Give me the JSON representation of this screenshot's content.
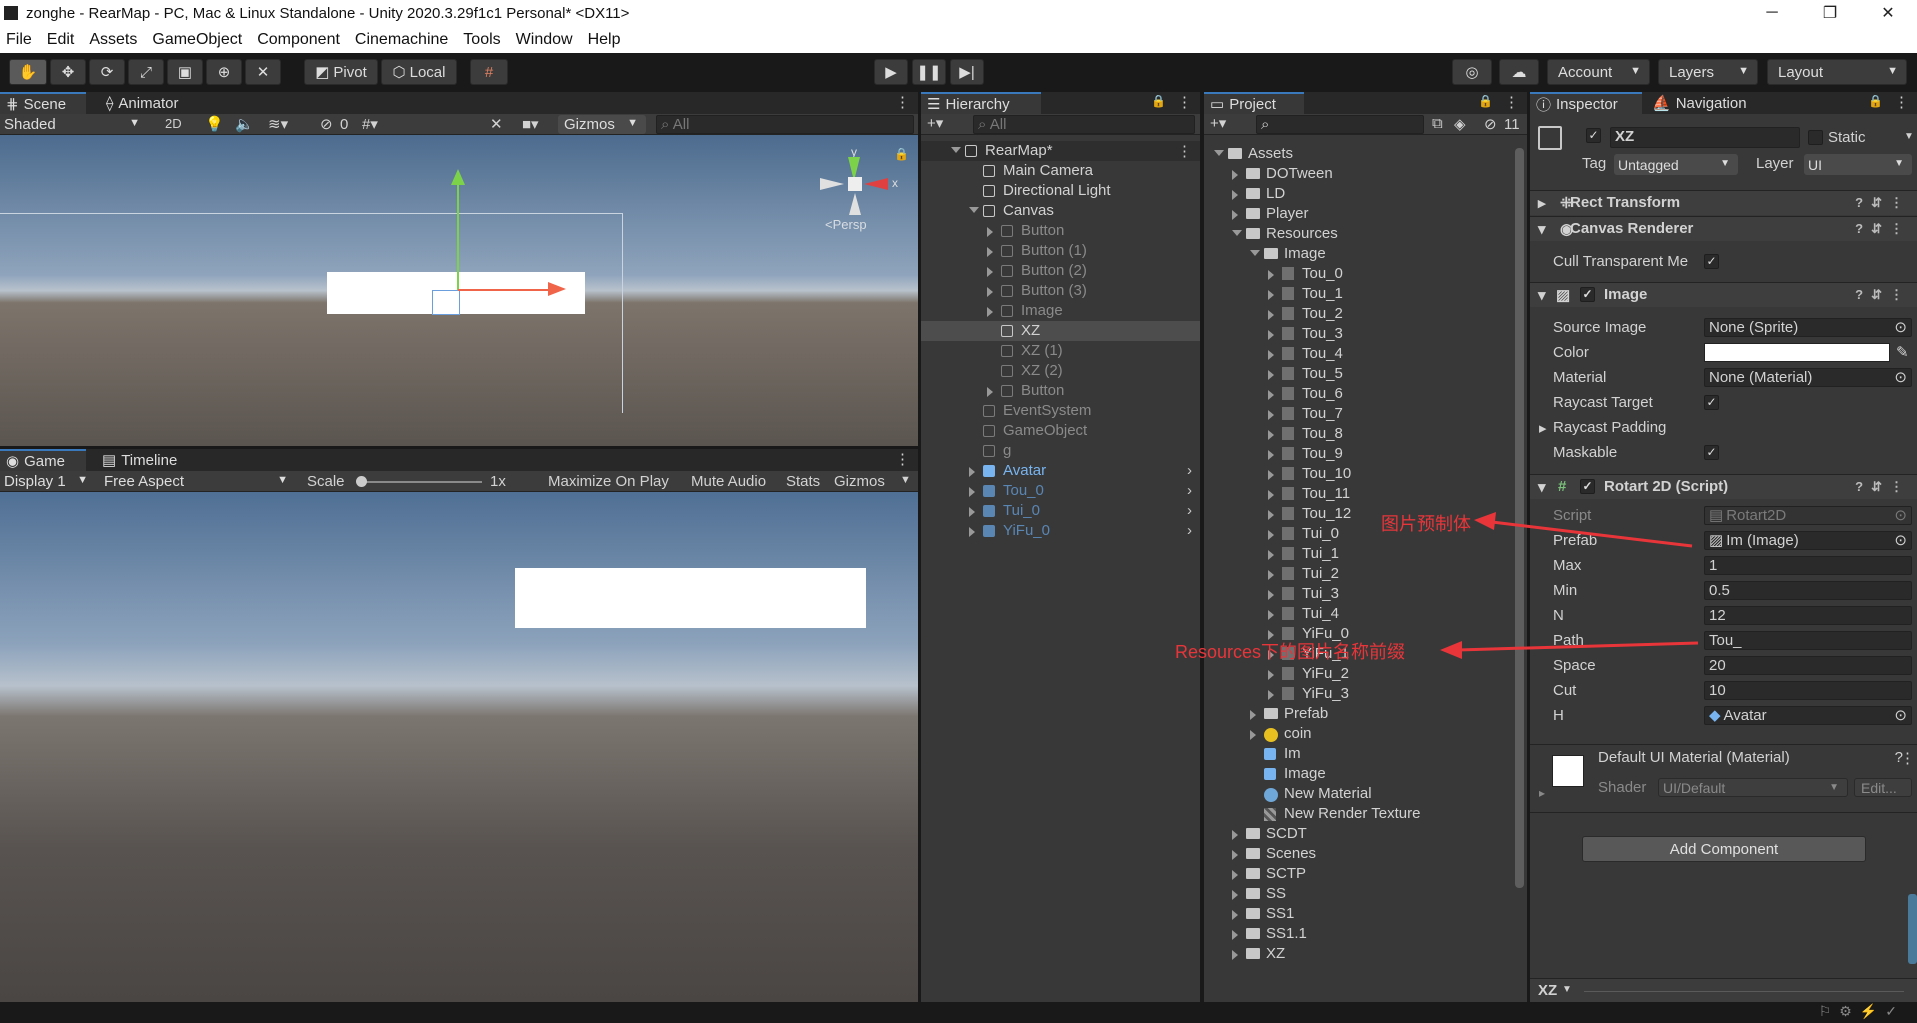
{
  "window": {
    "title": "zonghe - RearMap - PC, Mac & Linux Standalone - Unity 2020.3.29f1c1 Personal* <DX11>",
    "controls": [
      "─",
      "❐",
      "✕"
    ]
  },
  "menu": [
    "File",
    "Edit",
    "Assets",
    "GameObject",
    "Component",
    "Cinemachine",
    "Tools",
    "Window",
    "Help"
  ],
  "toolbar": {
    "pivot": "Pivot",
    "local": "Local",
    "account": "Account",
    "layers": "Layers",
    "layout": "Layout"
  },
  "scene": {
    "tabs": [
      "Scene",
      "Animator"
    ],
    "shading": "Shaded",
    "mode2d": "2D",
    "hidden_count": "0",
    "gizmos": "Gizmos",
    "search_placeholder": "All",
    "axis_y": "y",
    "axis_x": "x",
    "persp": "<Persp"
  },
  "game": {
    "tabs": [
      "Game",
      "Timeline"
    ],
    "display": "Display 1",
    "aspect": "Free Aspect",
    "scale_label": "Scale",
    "scale_value": "1x",
    "buttons": [
      "Maximize On Play",
      "Mute Audio",
      "Stats",
      "Gizmos"
    ]
  },
  "hierarchy": {
    "tab": "Hierarchy",
    "search_placeholder": "All",
    "items": [
      {
        "label": "RearMap*",
        "depth": 0,
        "arrow": "down",
        "style": "scene"
      },
      {
        "label": "Main Camera",
        "depth": 1,
        "arrow": "",
        "style": "normal"
      },
      {
        "label": "Directional Light",
        "depth": 1,
        "arrow": "",
        "style": "normal"
      },
      {
        "label": "Canvas",
        "depth": 1,
        "arrow": "down",
        "style": "normal"
      },
      {
        "label": "Button",
        "depth": 2,
        "arrow": "right",
        "style": "gray"
      },
      {
        "label": "Button (1)",
        "depth": 2,
        "arrow": "right",
        "style": "gray"
      },
      {
        "label": "Button (2)",
        "depth": 2,
        "arrow": "right",
        "style": "gray"
      },
      {
        "label": "Button (3)",
        "depth": 2,
        "arrow": "right",
        "style": "gray"
      },
      {
        "label": "Image",
        "depth": 2,
        "arrow": "right",
        "style": "gray"
      },
      {
        "label": "XZ",
        "depth": 2,
        "arrow": "",
        "style": "selected"
      },
      {
        "label": "XZ (1)",
        "depth": 2,
        "arrow": "",
        "style": "gray"
      },
      {
        "label": "XZ (2)",
        "depth": 2,
        "arrow": "",
        "style": "gray"
      },
      {
        "label": "Button",
        "depth": 2,
        "arrow": "right",
        "style": "gray"
      },
      {
        "label": "EventSystem",
        "depth": 1,
        "arrow": "",
        "style": "gray"
      },
      {
        "label": "GameObject",
        "depth": 1,
        "arrow": "",
        "style": "gray"
      },
      {
        "label": "g",
        "depth": 1,
        "arrow": "",
        "style": "gray"
      },
      {
        "label": "Avatar",
        "depth": 1,
        "arrow": "right",
        "style": "prefab"
      },
      {
        "label": "Tou_0",
        "depth": 1,
        "arrow": "right",
        "style": "prefab-dim"
      },
      {
        "label": "Tui_0",
        "depth": 1,
        "arrow": "right",
        "style": "prefab-dim"
      },
      {
        "label": "YiFu_0",
        "depth": 1,
        "arrow": "right",
        "style": "prefab-dim"
      }
    ]
  },
  "project": {
    "tab": "Project",
    "count": "11",
    "items": [
      {
        "label": "Assets",
        "depth": 0,
        "arrow": "down",
        "icon": "folder"
      },
      {
        "label": "DOTween",
        "depth": 1,
        "arrow": "right",
        "icon": "folder"
      },
      {
        "label": "LD",
        "depth": 1,
        "arrow": "right",
        "icon": "folder"
      },
      {
        "label": "Player",
        "depth": 1,
        "arrow": "right",
        "icon": "folder"
      },
      {
        "label": "Resources",
        "depth": 1,
        "arrow": "down",
        "icon": "folder"
      },
      {
        "label": "Image",
        "depth": 2,
        "arrow": "down",
        "icon": "folder"
      },
      {
        "label": "Tou_0",
        "depth": 3,
        "arrow": "right",
        "icon": "thumb"
      },
      {
        "label": "Tou_1",
        "depth": 3,
        "arrow": "right",
        "icon": "thumb"
      },
      {
        "label": "Tou_2",
        "depth": 3,
        "arrow": "right",
        "icon": "thumb"
      },
      {
        "label": "Tou_3",
        "depth": 3,
        "arrow": "right",
        "icon": "thumb"
      },
      {
        "label": "Tou_4",
        "depth": 3,
        "arrow": "right",
        "icon": "thumb"
      },
      {
        "label": "Tou_5",
        "depth": 3,
        "arrow": "right",
        "icon": "thumb"
      },
      {
        "label": "Tou_6",
        "depth": 3,
        "arrow": "right",
        "icon": "thumb"
      },
      {
        "label": "Tou_7",
        "depth": 3,
        "arrow": "right",
        "icon": "thumb"
      },
      {
        "label": "Tou_8",
        "depth": 3,
        "arrow": "right",
        "icon": "thumb"
      },
      {
        "label": "Tou_9",
        "depth": 3,
        "arrow": "right",
        "icon": "thumb"
      },
      {
        "label": "Tou_10",
        "depth": 3,
        "arrow": "right",
        "icon": "thumb"
      },
      {
        "label": "Tou_11",
        "depth": 3,
        "arrow": "right",
        "icon": "thumb"
      },
      {
        "label": "Tou_12",
        "depth": 3,
        "arrow": "right",
        "icon": "thumb"
      },
      {
        "label": "Tui_0",
        "depth": 3,
        "arrow": "right",
        "icon": "thumb"
      },
      {
        "label": "Tui_1",
        "depth": 3,
        "arrow": "right",
        "icon": "thumb"
      },
      {
        "label": "Tui_2",
        "depth": 3,
        "arrow": "right",
        "icon": "thumb"
      },
      {
        "label": "Tui_3",
        "depth": 3,
        "arrow": "right",
        "icon": "thumb"
      },
      {
        "label": "Tui_4",
        "depth": 3,
        "arrow": "right",
        "icon": "thumb"
      },
      {
        "label": "YiFu_0",
        "depth": 3,
        "arrow": "right",
        "icon": "thumb"
      },
      {
        "label": "YiFu_1",
        "depth": 3,
        "arrow": "right",
        "icon": "thumb"
      },
      {
        "label": "YiFu_2",
        "depth": 3,
        "arrow": "right",
        "icon": "thumb"
      },
      {
        "label": "YiFu_3",
        "depth": 3,
        "arrow": "right",
        "icon": "thumb"
      },
      {
        "label": "Prefab",
        "depth": 2,
        "arrow": "right",
        "icon": "folder"
      },
      {
        "label": "coin",
        "depth": 2,
        "arrow": "right",
        "icon": "coin"
      },
      {
        "label": "Im",
        "depth": 2,
        "arrow": "",
        "icon": "prefab"
      },
      {
        "label": "Image",
        "depth": 2,
        "arrow": "",
        "icon": "prefab"
      },
      {
        "label": "New Material",
        "depth": 2,
        "arrow": "",
        "icon": "material"
      },
      {
        "label": "New Render Texture",
        "depth": 2,
        "arrow": "",
        "icon": "texture"
      },
      {
        "label": "SCDT",
        "depth": 1,
        "arrow": "right",
        "icon": "folder"
      },
      {
        "label": "Scenes",
        "depth": 1,
        "arrow": "right",
        "icon": "folder"
      },
      {
        "label": "SCTP",
        "depth": 1,
        "arrow": "right",
        "icon": "folder"
      },
      {
        "label": "SS",
        "depth": 1,
        "arrow": "right",
        "icon": "folder"
      },
      {
        "label": "SS1",
        "depth": 1,
        "arrow": "right",
        "icon": "folder"
      },
      {
        "label": "SS1.1",
        "depth": 1,
        "arrow": "right",
        "icon": "folder"
      },
      {
        "label": "XZ",
        "depth": 1,
        "arrow": "right",
        "icon": "folder"
      }
    ]
  },
  "inspector": {
    "tabs": [
      "Inspector",
      "Navigation"
    ],
    "object_name": "XZ",
    "static_label": "Static",
    "tag_label": "Tag",
    "tag_value": "Untagged",
    "layer_label": "Layer",
    "layer_value": "UI",
    "rect_transform": "Rect Transform",
    "canvas_renderer": "Canvas Renderer",
    "cull_label": "Cull Transparent Me",
    "image_title": "Image",
    "image_fields": {
      "source_image_label": "Source Image",
      "source_image_value": "None (Sprite)",
      "color_label": "Color",
      "material_label": "Material",
      "material_value": "None (Material)",
      "raycast_target_label": "Raycast Target",
      "raycast_padding_label": "Raycast Padding",
      "maskable_label": "Maskable"
    },
    "rotart_title": "Rotart 2D (Script)",
    "rotart_fields": [
      {
        "label": "Script",
        "value": "Rotart2D",
        "kind": "ref-disabled"
      },
      {
        "label": "Prefab",
        "value": "Im (Image)",
        "kind": "ref"
      },
      {
        "label": "Max",
        "value": "1",
        "kind": "text"
      },
      {
        "label": "Min",
        "value": "0.5",
        "kind": "text"
      },
      {
        "label": "N",
        "value": "12",
        "kind": "text"
      },
      {
        "label": "Path",
        "value": "Tou_",
        "kind": "text"
      },
      {
        "label": "Space",
        "value": "20",
        "kind": "text"
      },
      {
        "label": "Cut",
        "value": "10",
        "kind": "text"
      },
      {
        "label": "H",
        "value": "Avatar",
        "kind": "ref"
      }
    ],
    "material_block": {
      "name": "Default UI Material (Material)",
      "shader_label": "Shader",
      "shader_value": "UI/Default",
      "edit": "Edit..."
    },
    "add_component": "Add Component",
    "footer_label": "XZ"
  },
  "annotations": [
    {
      "text": "图片预制体"
    },
    {
      "text": "Resources下的图片名称前缀"
    }
  ],
  "colors": {
    "accent": "#3a79bb",
    "annotation": "#e8353a",
    "panel": "#383838",
    "toolbar": "#191919"
  }
}
